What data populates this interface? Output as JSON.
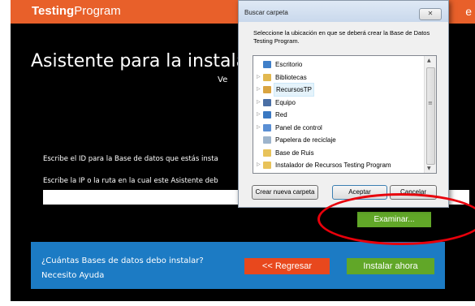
{
  "app": {
    "brand_bold": "Testing",
    "brand_rest": "Program",
    "topbar_right": "e",
    "main_title": "Asistente para la instalac",
    "subtitle": "Ve",
    "label_id": "Escribe el ID para la Base de datos que estás insta",
    "label_ip": "Escribe la IP o la ruta en la cual este Asistente deb",
    "ip_value": "",
    "browse_label": "Examinar...",
    "help_question": "¿Cuántas Bases de datos debo instalar?",
    "help_link": "Necesito Ayuda",
    "back_label": "<< Regresar",
    "install_label": "Instalar ahora"
  },
  "dialog": {
    "title": "Buscar carpeta",
    "close_label": "✕",
    "instructions": "Seleccione la ubicación en que se deberá crear la Base de Datos Testing Program.",
    "tree": [
      {
        "label": "Escritorio",
        "icon": "desktop-icon",
        "color": "#3f7fc9",
        "expander": ""
      },
      {
        "label": "Bibliotecas",
        "icon": "libraries-icon",
        "color": "#e2b84f",
        "expander": "▷"
      },
      {
        "label": "RecursosTP",
        "icon": "user-folder-icon",
        "color": "#d9a441",
        "expander": "▷",
        "selected": true
      },
      {
        "label": "Equipo",
        "icon": "computer-icon",
        "color": "#4a6fa5",
        "expander": "▷"
      },
      {
        "label": "Red",
        "icon": "network-icon",
        "color": "#3a78c2",
        "expander": "▷"
      },
      {
        "label": "Panel de control",
        "icon": "control-panel-icon",
        "color": "#5a8fd4",
        "expander": "▷"
      },
      {
        "label": "Papelera de reciclaje",
        "icon": "recycle-bin-icon",
        "color": "#9db4cc",
        "expander": ""
      },
      {
        "label": "Base de Ruis",
        "icon": "folder-icon",
        "color": "#e8c35a",
        "expander": ""
      },
      {
        "label": "Instalador de Recursos Testing Program",
        "icon": "folder-icon",
        "color": "#e8c35a",
        "expander": "▷"
      }
    ],
    "btn_new_folder": "Crear nueva carpeta",
    "btn_ok": "Aceptar",
    "btn_cancel": "Cancelar"
  }
}
